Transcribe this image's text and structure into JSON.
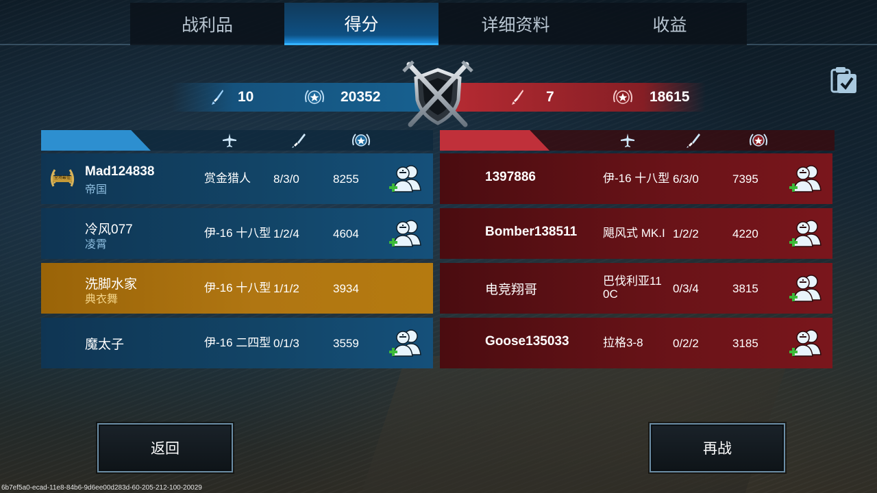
{
  "tabs": [
    {
      "label": "战利品",
      "active": false
    },
    {
      "label": "得分",
      "active": true
    },
    {
      "label": "详细资料",
      "active": false
    },
    {
      "label": "收益",
      "active": false
    }
  ],
  "banner": {
    "blue": {
      "kills": "10",
      "score": "20352"
    },
    "red": {
      "kills": "7",
      "score": "18615"
    }
  },
  "icons": {
    "plane": "plane-icon",
    "sword": "sword-icon",
    "star": "star-wreath-icon",
    "friend": "add-friend-icon",
    "emblem": "crossed-swords-shield-emblem",
    "clipboard": "clipboard-check-icon",
    "mvp": "mvp-laurel-badge"
  },
  "colors": {
    "blue_team": "#15507a",
    "red_team": "#7a161c",
    "highlight": "#b07612",
    "add_plus": "#3dbb3a"
  },
  "blue_team": [
    {
      "name": "Mad124838",
      "clan": "帝国",
      "plane": "赏金猎人",
      "kda": "8/3/0",
      "score": "8255",
      "mvp": true,
      "mvp_label": "全场最佳",
      "highlight": false,
      "bold": true
    },
    {
      "name": "冷风077",
      "clan": "凌霄",
      "plane": "伊-16 十八型",
      "kda": "1/2/4",
      "score": "4604",
      "mvp": false,
      "highlight": false,
      "bold": false
    },
    {
      "name": "洗脚水家",
      "clan": "典衣舞",
      "plane": "伊-16 十八型",
      "kda": "1/1/2",
      "score": "3934",
      "mvp": false,
      "highlight": true,
      "bold": false
    },
    {
      "name": "魔太子",
      "clan": "",
      "plane": "伊-16 二四型",
      "kda": "0/1/3",
      "score": "3559",
      "mvp": false,
      "highlight": false,
      "bold": false
    }
  ],
  "red_team": [
    {
      "name": "1397886",
      "plane": "伊-16 十八型",
      "kda": "6/3/0",
      "score": "7395"
    },
    {
      "name": "Bomber138511",
      "plane": "飓风式 MK.I",
      "kda": "1/2/2",
      "score": "4220"
    },
    {
      "name": "电竞翔哥",
      "plane": "巴伐利亚110C",
      "plane_line1": "巴伐利亚11",
      "plane_line2": "0C",
      "kda": "0/3/4",
      "score": "3815"
    },
    {
      "name": "Goose135033",
      "plane": "拉格3-8",
      "kda": "0/2/2",
      "score": "3185"
    }
  ],
  "buttons": {
    "back": "返回",
    "replay": "再战"
  },
  "footer_id": "6b7ef5a0-ecad-11e8-84b6-9d6ee00d283d-60-205-212-100-20029"
}
